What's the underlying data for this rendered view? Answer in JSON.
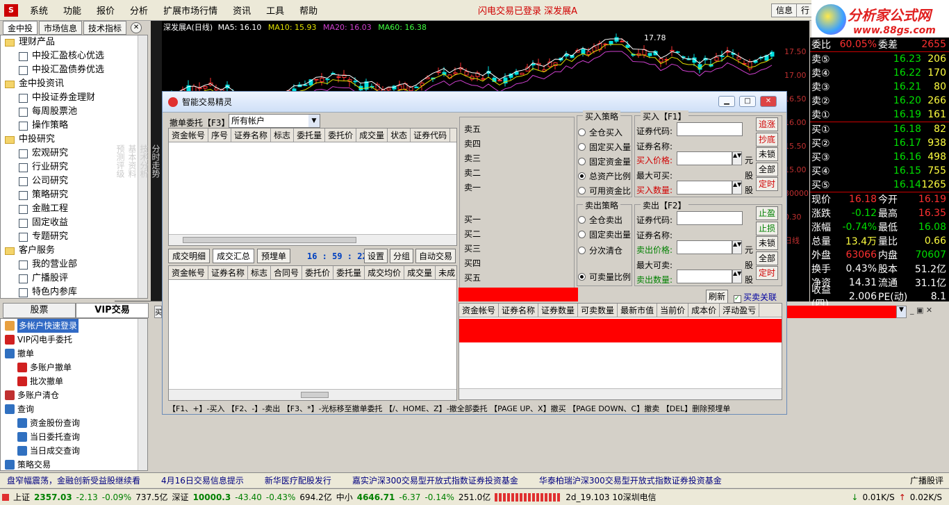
{
  "menu": {
    "items": [
      "系统",
      "功能",
      "报价",
      "分析",
      "扩展市场行情",
      "资讯",
      "工具",
      "帮助"
    ],
    "status": "闪电交易已登录  深发展A",
    "right_btn": "信息",
    "right_btn2": "行"
  },
  "brand": {
    "name": "分析家公式网",
    "url": "www.88gs.com"
  },
  "left_tabs": [
    "金中投",
    "市场信息",
    "技术指标"
  ],
  "tree": [
    {
      "type": "folder",
      "label": "理财产品"
    },
    {
      "type": "doc",
      "label": "中投汇盈核心优选"
    },
    {
      "type": "doc",
      "label": "中投汇盈债券优选"
    },
    {
      "type": "folder",
      "label": "金中投资讯"
    },
    {
      "type": "doc",
      "label": "中投证券金理财"
    },
    {
      "type": "doc",
      "label": "每周股票池"
    },
    {
      "type": "doc",
      "label": "操作策略"
    },
    {
      "type": "folder",
      "label": "中投研究"
    },
    {
      "type": "doc",
      "label": "宏观研究"
    },
    {
      "type": "doc",
      "label": "行业研究"
    },
    {
      "type": "doc",
      "label": "公司研究"
    },
    {
      "type": "doc",
      "label": "策略研究"
    },
    {
      "type": "doc",
      "label": "金融工程"
    },
    {
      "type": "doc",
      "label": "固定收益"
    },
    {
      "type": "doc",
      "label": "专题研究"
    },
    {
      "type": "folder",
      "label": "客户服务"
    },
    {
      "type": "doc",
      "label": "我的营业部"
    },
    {
      "type": "doc",
      "label": "广播股评"
    },
    {
      "type": "doc",
      "label": "特色内参库"
    }
  ],
  "bottom_tabs": [
    "股票",
    "VIP交易"
  ],
  "tree2": [
    {
      "label": "多帐户快速登录",
      "indent": 0,
      "icon": "user-icon",
      "color": "#e8a040",
      "selected": true
    },
    {
      "label": "VIP闪电手委托",
      "indent": 0,
      "icon": "arrow-icon",
      "color": "#d02020"
    },
    {
      "label": "撤单",
      "indent": 0,
      "icon": "magnifier-icon",
      "color": "#3070c0"
    },
    {
      "label": "多账户撤单",
      "indent": 1,
      "icon": "arrow-icon",
      "color": "#d02020"
    },
    {
      "label": "批次撤单",
      "indent": 1,
      "icon": "arrow-icon",
      "color": "#d02020"
    },
    {
      "label": "多账户清仓",
      "indent": 0,
      "icon": "sell-icon",
      "color": "#c03030"
    },
    {
      "label": "查询",
      "indent": 0,
      "icon": "magnifier-icon",
      "color": "#3070c0"
    },
    {
      "label": "资金股份查询",
      "indent": 1,
      "icon": "magnifier-icon",
      "color": "#3070c0"
    },
    {
      "label": "当日委托查询",
      "indent": 1,
      "icon": "magnifier-icon",
      "color": "#3070c0"
    },
    {
      "label": "当日成交查询",
      "indent": 1,
      "icon": "magnifier-icon",
      "color": "#3070c0"
    },
    {
      "label": "策略交易",
      "indent": 0,
      "icon": "strategy-icon",
      "color": "#3070c0"
    }
  ],
  "chart": {
    "title": "深发展A(日线)",
    "ma5": "MA5: 16.10",
    "ma10": "MA10: 15.93",
    "ma20": "MA20: 16.03",
    "ma60": "MA60: 16.38",
    "peak": "17.78",
    "axis": [
      "17.50",
      "17.00",
      "16.50",
      "16.00",
      "15.50",
      "15.00",
      "30000",
      "0.30",
      "日线"
    ],
    "vtabs": [
      "分时走势",
      "技术分析",
      "基本资料",
      "预测评级"
    ]
  },
  "quote": {
    "weibi_label": "委比",
    "weibi": "60.05%",
    "weicha_label": "委差",
    "weicha": "2655",
    "sell": [
      {
        "label": "卖⑤",
        "price": "16.23",
        "vol": "206"
      },
      {
        "label": "卖④",
        "price": "16.22",
        "vol": "170"
      },
      {
        "label": "卖③",
        "price": "16.21",
        "vol": "80"
      },
      {
        "label": "卖②",
        "price": "16.20",
        "vol": "266"
      },
      {
        "label": "卖①",
        "price": "16.19",
        "vol": "161"
      }
    ],
    "buy": [
      {
        "label": "买①",
        "price": "16.18",
        "vol": "82"
      },
      {
        "label": "买②",
        "price": "16.17",
        "vol": "938"
      },
      {
        "label": "买③",
        "price": "16.16",
        "vol": "498"
      },
      {
        "label": "买④",
        "price": "16.15",
        "vol": "755"
      },
      {
        "label": "买⑤",
        "price": "16.14",
        "vol": "1265"
      }
    ],
    "stats": [
      {
        "l1": "现价",
        "v1": "16.18",
        "c1": "red",
        "l2": "今开",
        "v2": "16.19",
        "c2": "red"
      },
      {
        "l1": "涨跌",
        "v1": "-0.12",
        "c1": "grn",
        "l2": "最高",
        "v2": "16.35",
        "c2": "red"
      },
      {
        "l1": "涨幅",
        "v1": "-0.74%",
        "c1": "grn",
        "l2": "最低",
        "v2": "16.08",
        "c2": "grn"
      },
      {
        "l1": "总量",
        "v1": "13.4万",
        "c1": "yel",
        "l2": "量比",
        "v2": "0.66",
        "c2": "yel"
      },
      {
        "l1": "外盘",
        "v1": "63066",
        "c1": "red",
        "l2": "内盘",
        "v2": "70607",
        "c2": "grn"
      },
      {
        "l1": "换手",
        "v1": "0.43%",
        "c1": "wht",
        "l2": "股本",
        "v2": "51.2亿",
        "c2": "wht"
      },
      {
        "l1": "净资",
        "v1": "14.31",
        "c1": "wht",
        "l2": "流通",
        "v2": "31.1亿",
        "c2": "wht"
      },
      {
        "l1": "收益(四)",
        "v1": "2.006",
        "c1": "wht",
        "l2": "PE(动)",
        "v2": "8.1",
        "c2": "wht"
      }
    ]
  },
  "dialog": {
    "title": "智能交易精灵",
    "cancel_label": "撤单委托【F3】",
    "account_select": "所有帐户",
    "order_cols": [
      "资金帐号",
      "序号",
      "证券名称",
      "标志",
      "委托量",
      "委托价",
      "成交量",
      "状态",
      "证券代码"
    ],
    "tabs": [
      "成交明细",
      "成交汇总",
      "预埋单"
    ],
    "clock": "16 : 59 : 22",
    "tools": [
      "设置",
      "分组",
      "自动交易"
    ],
    "trade_cols": [
      "资金帐号",
      "证券名称",
      "标志",
      "合同号",
      "委托价",
      "委托量",
      "成交均价",
      "成交量",
      "未成"
    ],
    "book_sell": [
      "卖五",
      "卖四",
      "卖三",
      "卖二",
      "卖一"
    ],
    "book_buy": [
      "买一",
      "买二",
      "买三",
      "买四",
      "买五"
    ],
    "buy_strategy": {
      "title": "买入策略",
      "options": [
        "全仓买入",
        "固定买入量",
        "固定资金量",
        "总资产比例",
        "可用资金比"
      ],
      "selected": 3
    },
    "buy_panel": {
      "title": "买入【F1】",
      "code": "证券代码:",
      "name": "证券名称:",
      "price": "买入价格:",
      "max": "最大可买:",
      "qty": "买入数量:",
      "unit_yuan": "元",
      "unit_gu": "股"
    },
    "buy_btns": [
      "追涨",
      "抄底",
      "未锁",
      "全部",
      "定时"
    ],
    "sell_strategy": {
      "title": "卖出策略",
      "options": [
        "全仓卖出",
        "固定卖出量",
        "分次清仓",
        "可卖量比例"
      ],
      "selected": 3
    },
    "sell_panel": {
      "title": "卖出【F2】",
      "code": "证券代码:",
      "name": "证券名称:",
      "price": "卖出价格:",
      "max": "最大可卖:",
      "qty": "卖出数量:",
      "unit_yuan": "元",
      "unit_gu": "股"
    },
    "sell_btns": [
      "止盈",
      "止损",
      "未锁",
      "全部",
      "定时"
    ],
    "refresh": "刷新",
    "link": "买卖关联",
    "pos_cols": [
      "资金帐号",
      "证券名称",
      "证券数量",
      "可卖数量",
      "最新市值",
      "当前价",
      "成本价",
      "浮动盈亏"
    ],
    "hotkeys": "【F1、+】-买入  【F2、-】-卖出  【F3、*】-光标移至撤单委托  【/、HOME、Z】-撤全部委托  【PAGE UP、X】撤买  【PAGE DOWN、C】撤卖  【DEL】删除预埋单"
  },
  "ticker": [
    "盘窄幅震荡，金融创新受益股继续看",
    "4月16日交易信息提示",
    "新华医疗配股发行",
    "嘉实沪深300交易型开放式指数证券投资基金",
    "华泰柏瑞沪深300交易型开放式指数证券投资基金",
    "广播股评"
  ],
  "statusbar": {
    "sh_label": "上证",
    "sh": "2357.03",
    "sh_chg": "-2.13",
    "sh_pct": "-0.09%",
    "sh_amt": "737.5亿",
    "sz_label": "深证",
    "sz": "10000.3",
    "sz_chg": "-43.40",
    "sz_pct": "-0.43%",
    "sz_amt": "694.2亿",
    "zx_label": "中小",
    "zx": "4646.71",
    "zx_chg": "-6.37",
    "zx_pct": "-0.14%",
    "zx_amt": "251.0亿",
    "server": "2d_19.103 10深圳电信",
    "down": "0.01K/S",
    "up": "0.02K/S"
  }
}
